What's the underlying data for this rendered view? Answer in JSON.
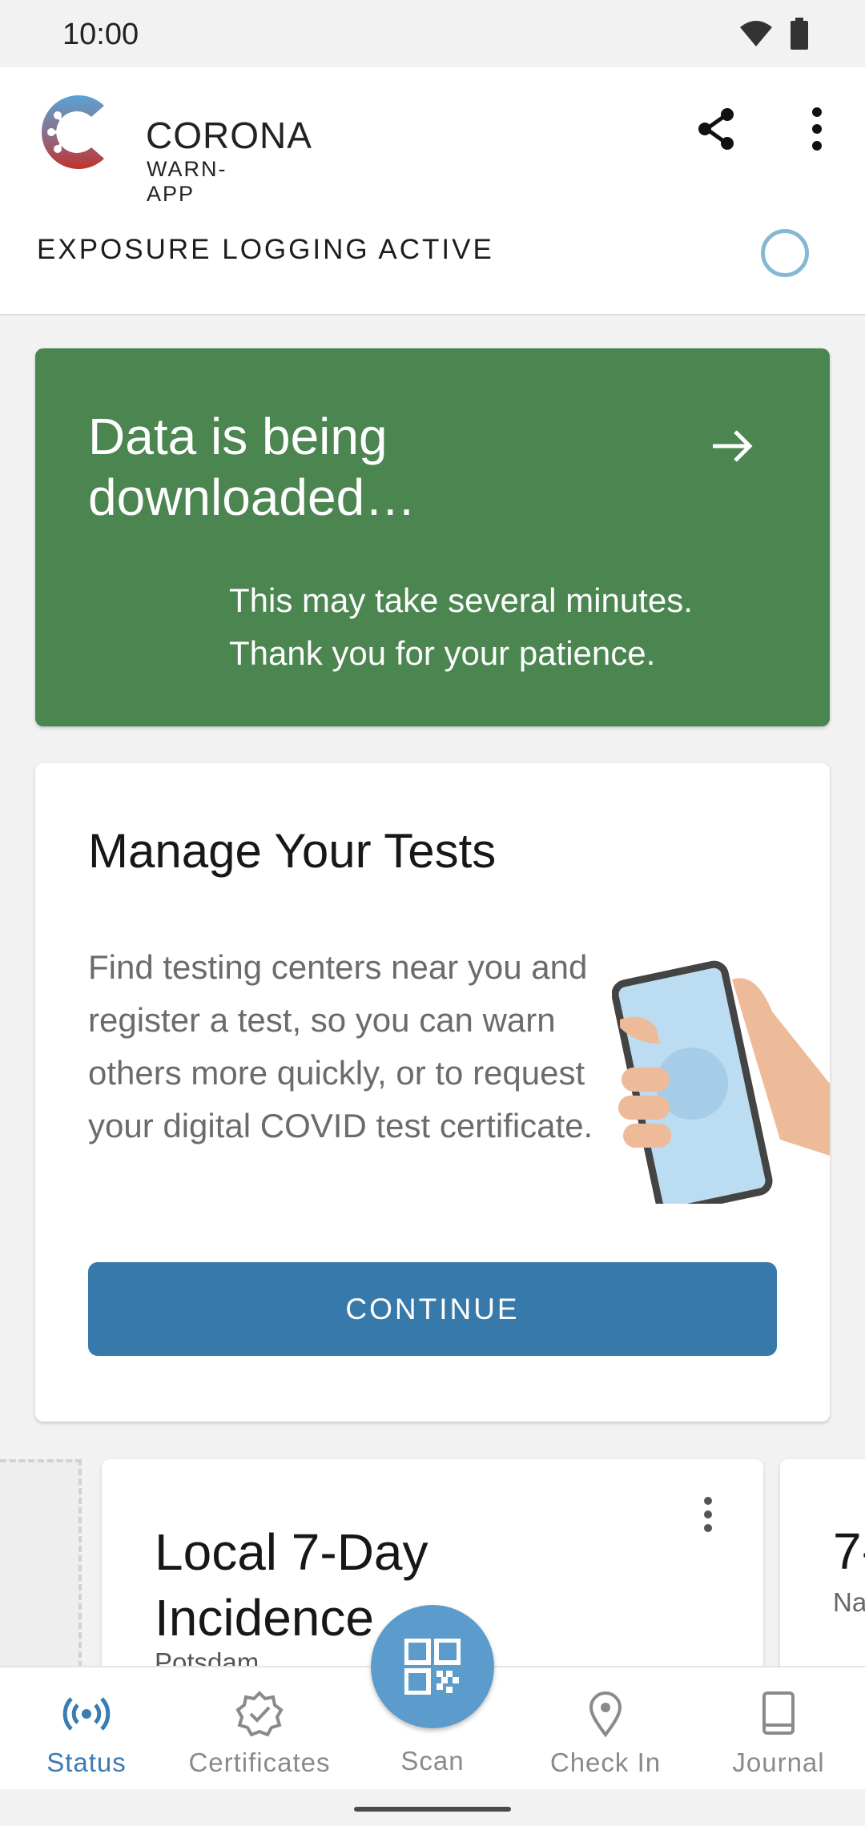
{
  "status_bar": {
    "time": "10:00"
  },
  "header": {
    "logo_line1": "CORONA",
    "logo_line2": "WARN-APP",
    "exposure_status": "EXPOSURE LOGGING ACTIVE"
  },
  "download_card": {
    "title": "Data is being downloaded…",
    "body": "This may take several minutes. Thank you for your patience.",
    "color": "#4b8550"
  },
  "tests_card": {
    "title": "Manage Your Tests",
    "body": "Find testing centers near you and register a test, so you can warn others more quickly, or to request your digital COVID test certificate.",
    "button_label": "CONTINUE",
    "button_color": "#3879ab"
  },
  "incidence_card": {
    "title": "Local 7-Day Incidence",
    "subtitle": "Potsdam"
  },
  "next_card": {
    "title": "7-",
    "subtitle": "Na"
  },
  "bottom_nav": {
    "items": [
      {
        "label": "Status",
        "icon": "broadcast-icon",
        "active": true
      },
      {
        "label": "Certificates",
        "icon": "certificate-badge-icon",
        "active": false
      },
      {
        "label": "Scan",
        "icon": "qr-code-icon",
        "active": false
      },
      {
        "label": "Check In",
        "icon": "location-pin-icon",
        "active": false
      },
      {
        "label": "Journal",
        "icon": "book-icon",
        "active": false
      }
    ],
    "active_color": "#3c7cb3"
  }
}
